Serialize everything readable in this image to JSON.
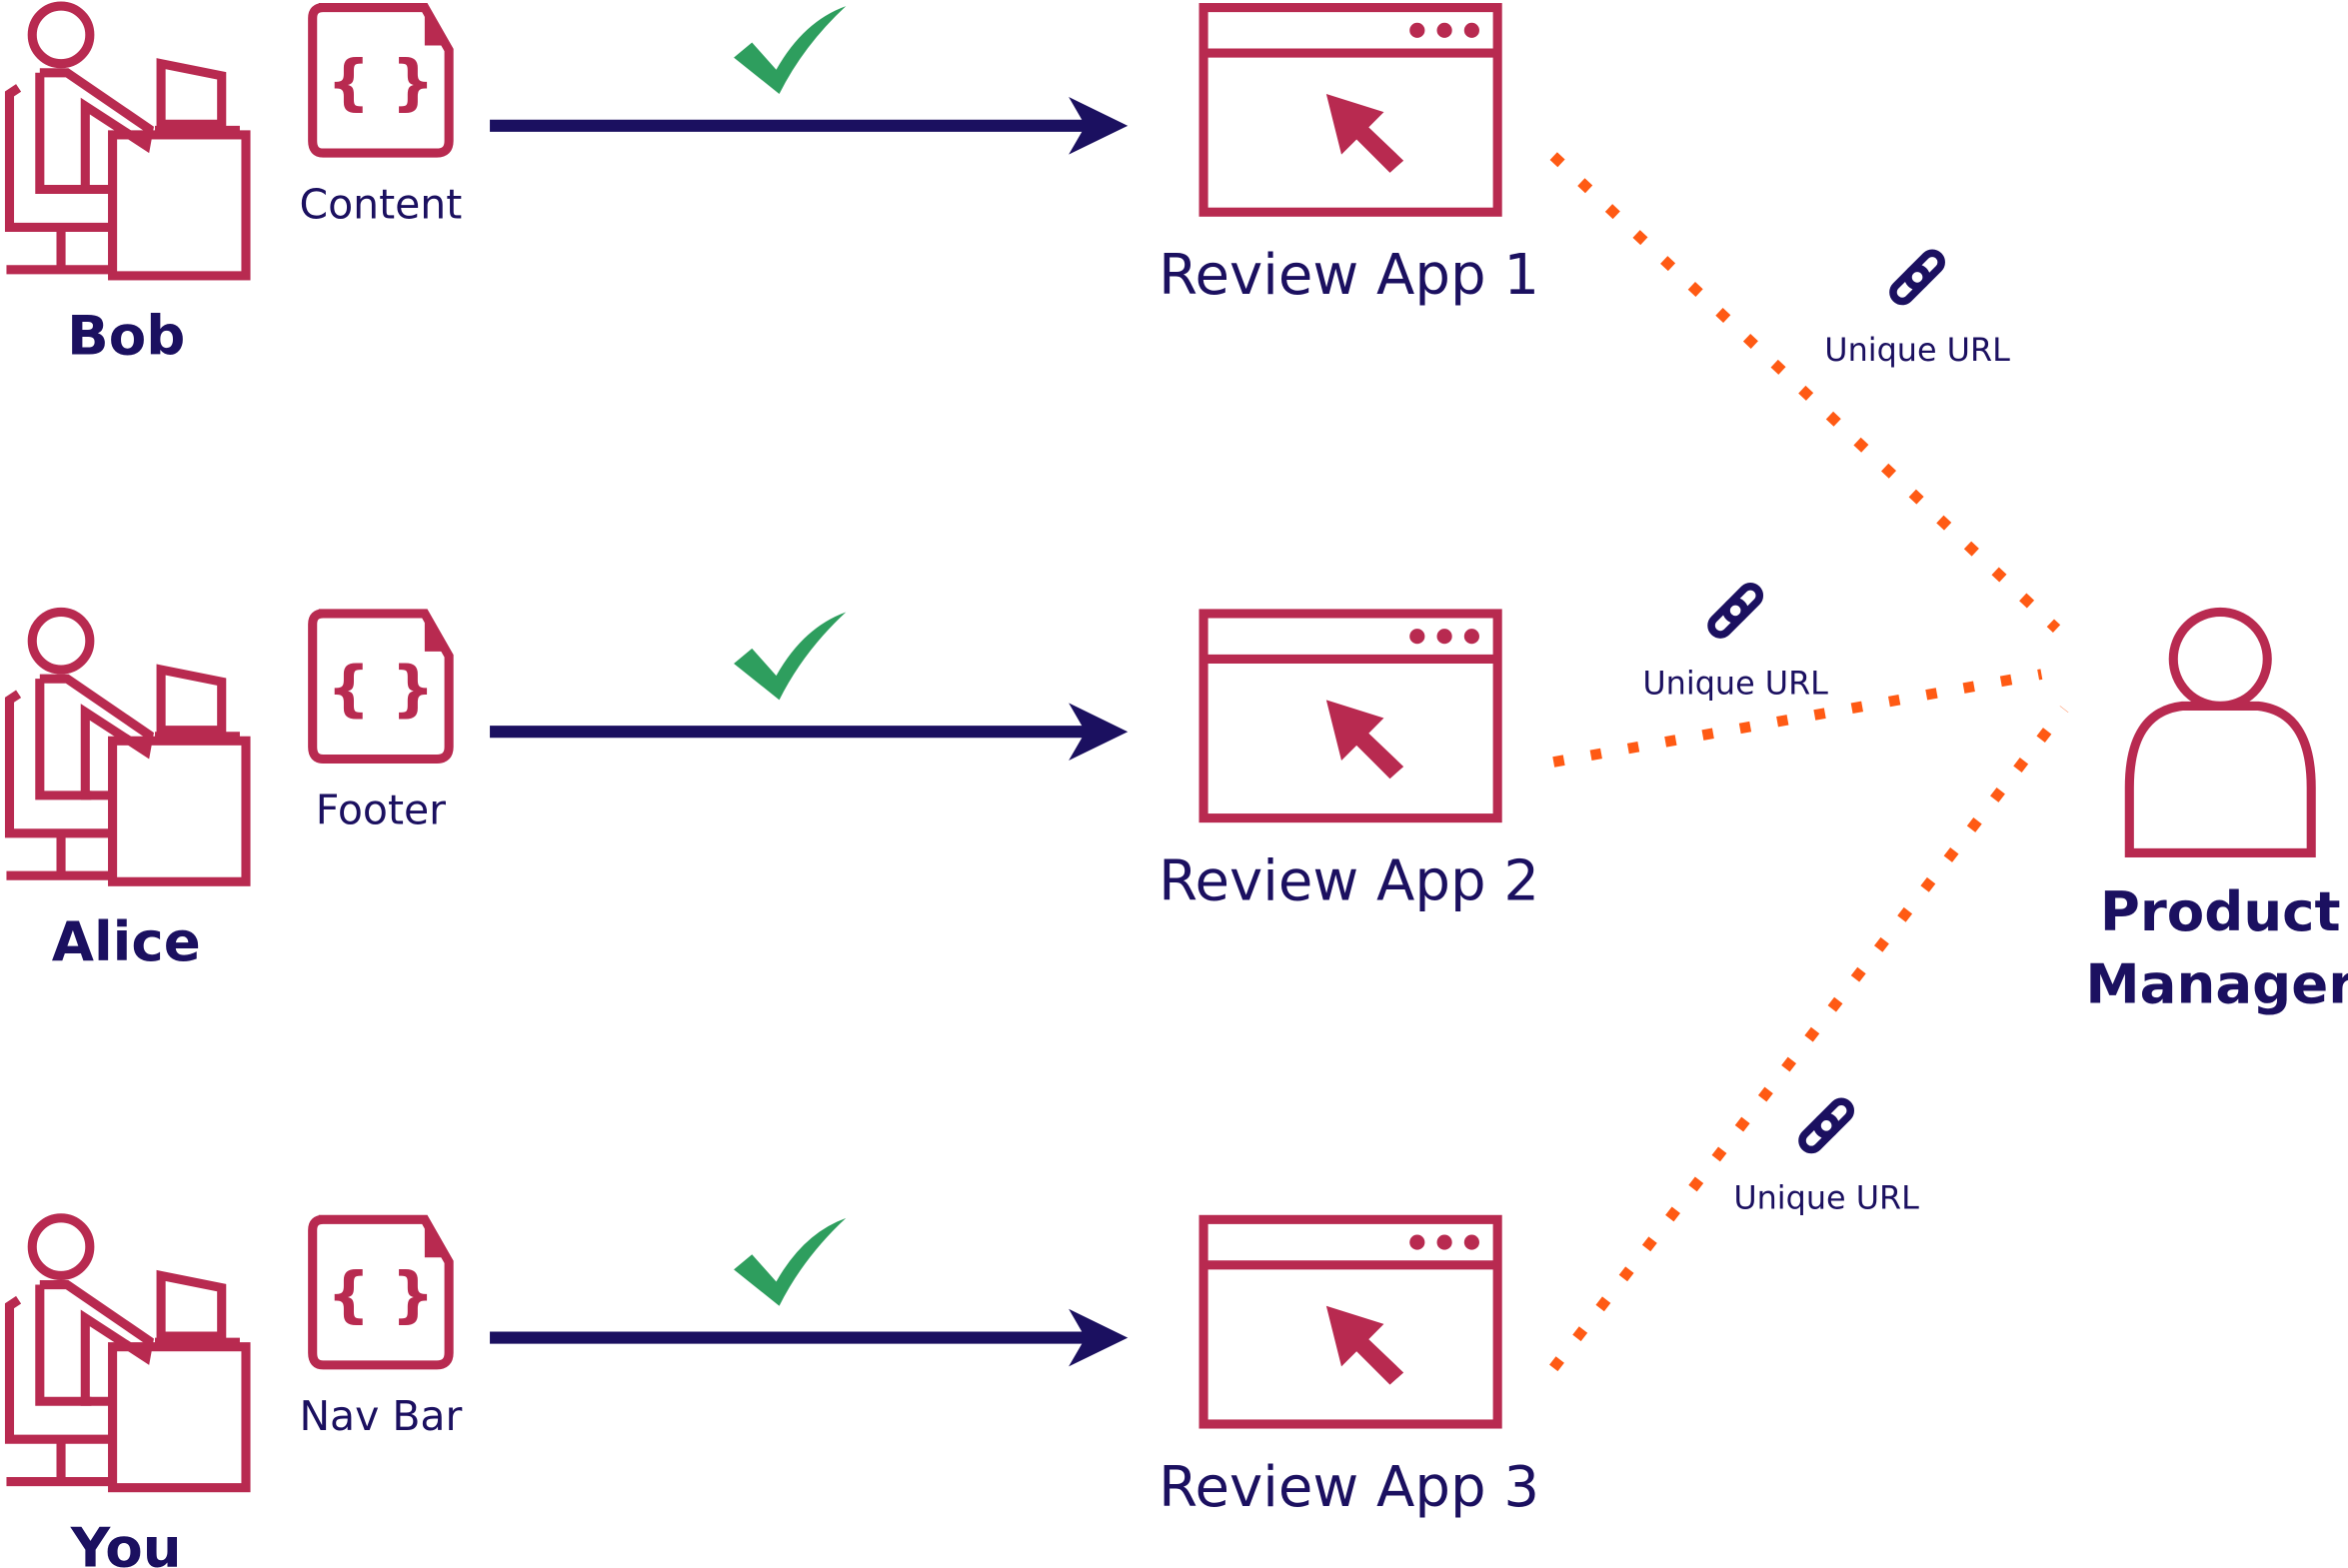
{
  "colors": {
    "primary": "#b82a50",
    "text": "#1b1060",
    "check": "#2e9e5e",
    "link_line": "#ff5a14"
  },
  "rows": [
    {
      "person": "Bob",
      "component": "Content",
      "app": "Review App 1"
    },
    {
      "person": "Alice",
      "component": "Footer",
      "app": "Review App 2"
    },
    {
      "person": "You",
      "component": "Nav Bar",
      "app": "Review App 3"
    }
  ],
  "document_icon_glyph": "{ }",
  "links": [
    {
      "label": "Unique URL"
    },
    {
      "label": "Unique URL"
    },
    {
      "label": "Unique URL"
    }
  ],
  "reviewer": {
    "line1": "Product",
    "line2": "Manager"
  }
}
